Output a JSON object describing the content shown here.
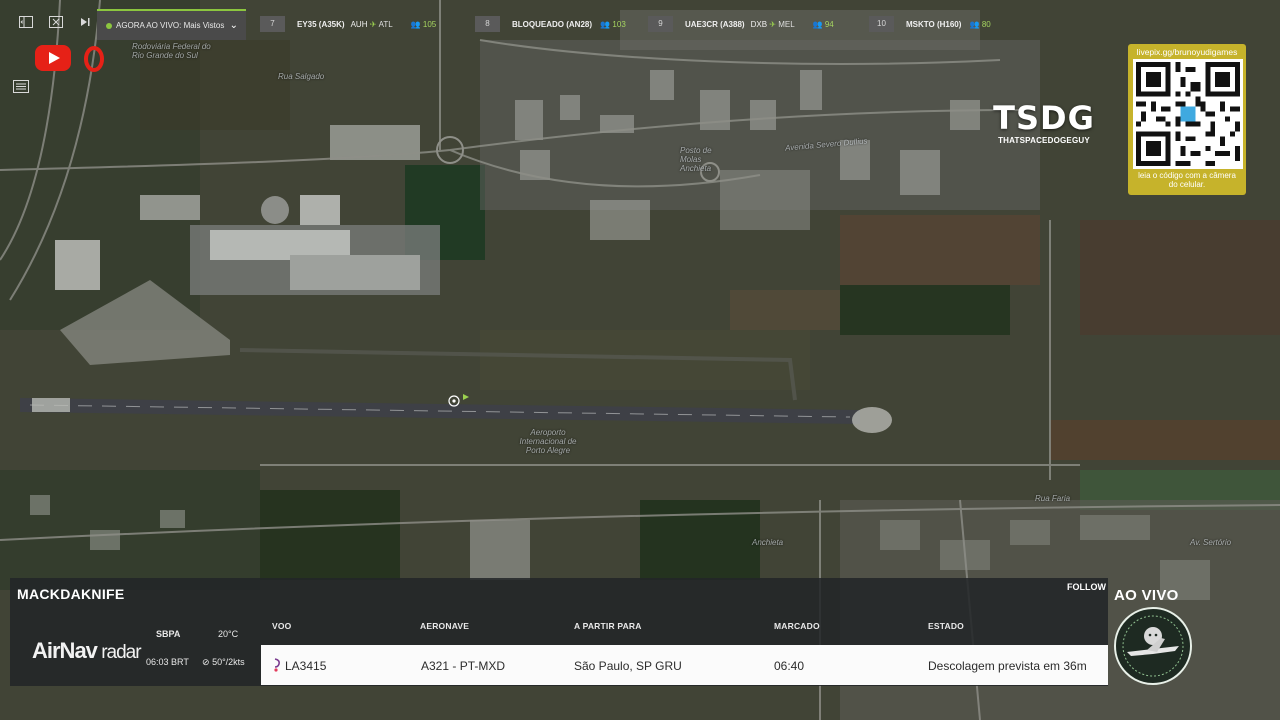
{
  "toolbar": {
    "live_label": "AGORA AO VIVO: Mais Vistos",
    "flights": [
      {
        "rank": "7",
        "code": "EY35 (A35K)",
        "origin": "AUH",
        "dest": "ATL",
        "views": "105"
      },
      {
        "rank": "8",
        "code": "BLOQUEADO (AN28)",
        "origin": "",
        "dest": "",
        "views": "103"
      },
      {
        "rank": "9",
        "code": "UAE3CR (A388)",
        "origin": "DXB",
        "dest": "MEL",
        "views": "94"
      },
      {
        "rank": "10",
        "code": "MSKTO (H160)",
        "origin": "",
        "dest": "",
        "views": "80"
      }
    ]
  },
  "logo": {
    "text": "TSDG",
    "subtitle": "THATSPACEDOGEGUY"
  },
  "qr": {
    "url": "livepix.gg/brunoyudigames",
    "caption": "leia o código com a câmera do celular."
  },
  "map_labels": {
    "airport": "Aeroporto Internacional de Porto Alegre",
    "l1": "Rodoviária Federal do Rio Grande do Sul",
    "l2": "Avenida Severo Dullius",
    "l3": "Posto de Molas Anchieta",
    "l4": "Rua Salgado",
    "l5": "Av. Sertório",
    "l6": "Rua Faria",
    "l7": "Anchieta"
  },
  "panel": {
    "username": "MACKDAKNIFE",
    "follow": "FOLLOW",
    "brand_a": "AirNav",
    "brand_b": " radar",
    "airport_code": "SBPA",
    "local_time": "06:03 BRT",
    "temperature": "20°C",
    "wind": "50°/2kts",
    "headers": {
      "flight": "VOO",
      "aircraft": "AERONAVE",
      "route": "A PARTIR PARA",
      "scheduled": "MARCADO",
      "status": "ESTADO"
    },
    "row": {
      "flight": "LA3415",
      "aircraft": "A321 - PT-MXD",
      "route": "São Paulo, SP GRU",
      "scheduled": "06:40",
      "status": "Descolagem prevista em 36m"
    }
  },
  "ao_vivo": "AO VIVO",
  "colors": {
    "accent_green": "#8cc63f",
    "qr_gold": "#c6b32b",
    "youtube_red": "#e62117",
    "airline_purple": "#7a3b8f"
  }
}
